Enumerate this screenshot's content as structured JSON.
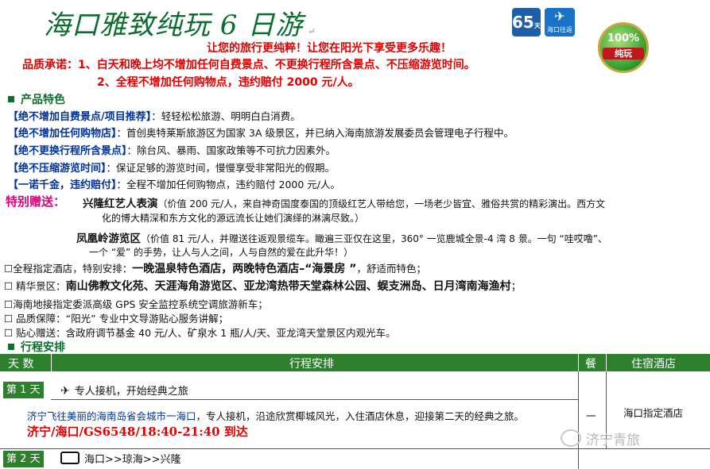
{
  "header": {
    "title": "海口雅致纯玩 6 日游",
    "return_mark": "↵",
    "slogan": "让您的旅行更纯粹！让您在阳光下享受更多乐趣！",
    "promise_1": "品质承诺：1、白天和晚上均不增加任何自费景点、不更换行程所含景点、不压缩游览时间。",
    "promise_2": "2、全程不增加任何购物点，违约赔付 2000 元/人。",
    "logos": {
      "days": "65",
      "days_sub": "天晚",
      "airline": "海口往返",
      "seal_top": "100%",
      "seal_band": "纯玩"
    }
  },
  "features": {
    "heading": "产品特色",
    "items": [
      {
        "key": "【绝不增加自费景点/项目推荐】",
        "text": "：轻轻松松旅游、明明白白消费。"
      },
      {
        "key": "【绝不增加任何购物店】",
        "text": "：首创奥特莱斯旅游区为国家 3A 级景区，并已纳入海南旅游发展委员会管理电子行程中。"
      },
      {
        "key": "【绝不更换行程所含景点】",
        "text": "：除台风、暴雨、国家政策等不可抗力因素外。"
      },
      {
        "key": "【绝不压缩游览时间】",
        "text": "：保证足够的游览时间，慢慢享受非常阳光的假期。"
      },
      {
        "key": "【一诺千金，违约赔付】",
        "text": "：全程不增加任何购物点，违约赔付 2000 元/人。"
      }
    ]
  },
  "gifts": {
    "label": "特别赠送：",
    "g1_name": "兴隆红艺人表演",
    "g1_line1": "（价值 200 元/人，来自神奇国度泰国的顶级红艺人带给您，一场老少皆宜、雅俗共赏的精彩演出。西方文",
    "g1_line2": "化的博大精深和东方文化的源远流长让她们演绎的淋漓尽致。）",
    "g2_name": "凤凰岭游览区",
    "g2_line1": "（价值 81 元/人，并赠送往返观景缆车。瞰遍三亚仅在这里，360° 一览鹿城全景-4 湾 8 景。一句 “哇哎噜”、",
    "g2_line2": "一个 “爱” 的手势，让人与人之间，人与自然的爱在此升华！）"
  },
  "services": [
    {
      "pre": "☐全程指定酒店，特别安排：",
      "bold": "一晚温泉特色酒店，两晚特色酒店–“海景房 ”",
      "post": "，舒适而特色；"
    },
    {
      "pre": "☐  精华景区：",
      "bold": "南山佛教文化苑、天涯海角游览区、亚龙湾热带天堂森林公园、蜈支洲岛、日月湾南海渔村",
      "post": "；"
    },
    {
      "pre": "☐海南地接指定委派高级 GPS 安全监控系统空调旅游新车；",
      "bold": "",
      "post": ""
    },
    {
      "pre": "☐  品质保障：“阳光” 专业中文导游贴心服务讲解；",
      "bold": "",
      "post": ""
    },
    {
      "pre": "☐  贴心赠送：含政府调节基金 40 元/人、矿泉水 1 瓶/人/天、亚龙湾天堂景区内观光车。",
      "bold": "",
      "post": ""
    }
  ],
  "itinerary": {
    "heading": "行程安排",
    "columns": {
      "day": "天  数",
      "plan": "行程安排",
      "meal": "餐",
      "hotel": "住宿酒店"
    },
    "day1": {
      "label": "第 1 天",
      "title": "专人接机，开始经典之旅",
      "desc_blue": "济宁飞往美丽的海南岛省会城市一海口",
      "desc_rest": "，专人接机，沿途欣赏椰城风光，入住酒店休息，迎接第二天的经典之旅。",
      "flight": "济宁/海口/GS6548/18:40-21:40 到达",
      "meal": "一",
      "hotel": "海口指定酒店"
    },
    "day2": {
      "label": "第 2 天",
      "title": "海口>>琼海>>兴隆"
    }
  },
  "watermark": "济宁青旅"
}
